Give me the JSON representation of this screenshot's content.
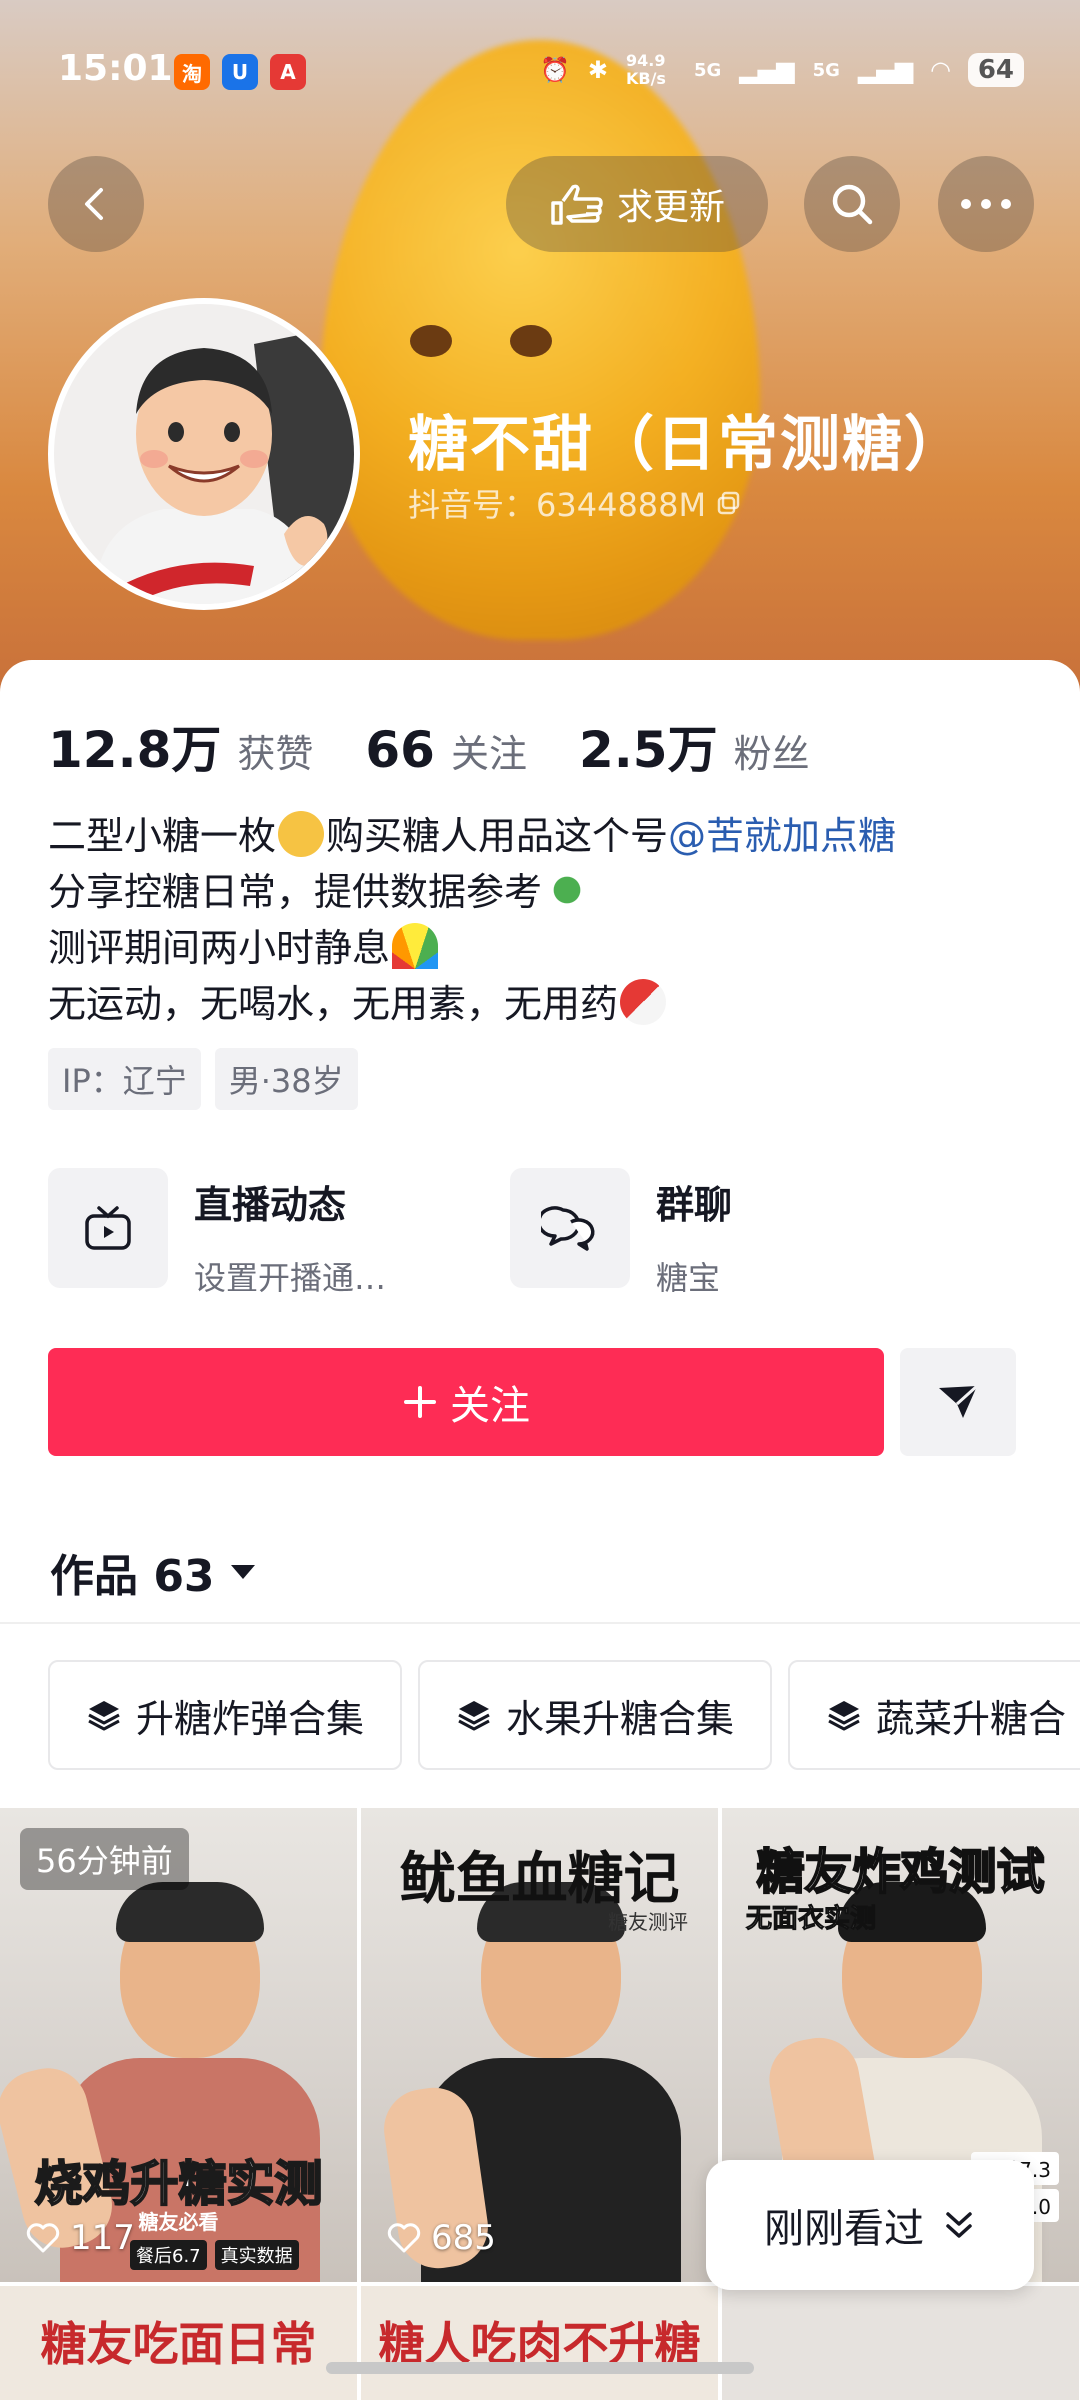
{
  "status_bar": {
    "time": "15:01",
    "apps": [
      "淘",
      "U",
      "A"
    ],
    "net_speed": "94.9 KB/s",
    "signal1": "5G",
    "signal2": "5G",
    "battery": "64"
  },
  "nav": {
    "request_update_label": "求更新"
  },
  "profile": {
    "name": "糖不甜（日常测糖）",
    "douyin_id": "抖音号：6344888M"
  },
  "stats": [
    {
      "value": "12.8万",
      "label": "获赞"
    },
    {
      "value": "66",
      "label": "关注"
    },
    {
      "value": "2.5万",
      "label": "粉丝"
    }
  ],
  "bio": {
    "line1_a": "二型小糖一枚",
    "line1_b": "购买糖人用品这个号",
    "line1_mention": "@苦就加点糖",
    "line2": "分享控糖日常，提供数据参考",
    "line3": "测评期间两小时静息",
    "line4": "无运动，无喝水，无用素，无用药"
  },
  "tags": [
    "IP：辽宁",
    "男·38岁"
  ],
  "features": [
    {
      "title": "直播动态",
      "subtitle": "设置开播通…"
    },
    {
      "title": "群聊",
      "subtitle": "糖宝"
    }
  ],
  "actions": {
    "follow_label": "关注"
  },
  "works": {
    "label": "作品 63"
  },
  "collections": [
    "升糖炸弹合集",
    "水果升糖合集",
    "蔬菜升糖合"
  ],
  "videos": [
    {
      "time_badge": "56分钟前",
      "title": "烧鸡升糖实测",
      "subtitle": "糖友必看",
      "chip1": "餐后6.7",
      "chip2": "真实数据",
      "likes": "117"
    },
    {
      "title": "鱿鱼血糖记",
      "subtitle": "糖友测评",
      "likes": "685"
    },
    {
      "title": "糖友炸鸡测试",
      "subtitle": "无面衣实测",
      "note1": "餐前7.3",
      "note2": "餐后8.0",
      "likes": ""
    },
    {
      "title": "糖友吃面日常"
    },
    {
      "title": "糖人吃肉不升糖"
    }
  ],
  "recent": {
    "label": "刚刚看过"
  },
  "colors": {
    "primary": "#fe2c55",
    "mention": "#2a5db0",
    "header_orange": "#d9883f"
  }
}
